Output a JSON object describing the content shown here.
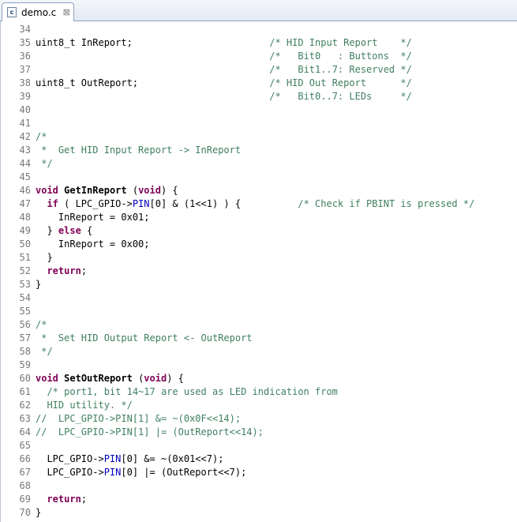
{
  "tab": {
    "title": "demo.c",
    "file_icon_text": "c",
    "close_glyph": "⊠"
  },
  "colors": {
    "keyword": "#7f0055",
    "comment": "#3f7f5f",
    "macro": "#0000c0",
    "line_number": "#787878"
  },
  "lines": [
    {
      "number": "34",
      "segments": []
    },
    {
      "number": "35",
      "segments": [
        {
          "t": "plain",
          "v": "uint8_t InReport;                        "
        },
        {
          "t": "comment",
          "v": "/* HID Input Report    */"
        }
      ]
    },
    {
      "number": "36",
      "segments": [
        {
          "t": "plain",
          "v": "                                         "
        },
        {
          "t": "comment",
          "v": "/*   Bit0   : Buttons  */"
        }
      ]
    },
    {
      "number": "37",
      "segments": [
        {
          "t": "plain",
          "v": "                                         "
        },
        {
          "t": "comment",
          "v": "/*   Bit1..7: Reserved */"
        }
      ]
    },
    {
      "number": "38",
      "segments": [
        {
          "t": "plain",
          "v": "uint8_t OutReport;                       "
        },
        {
          "t": "comment",
          "v": "/* HID Out Report      */"
        }
      ]
    },
    {
      "number": "39",
      "segments": [
        {
          "t": "plain",
          "v": "                                         "
        },
        {
          "t": "comment",
          "v": "/*   Bit0..7: LEDs     */"
        }
      ]
    },
    {
      "number": "40",
      "segments": []
    },
    {
      "number": "41",
      "segments": []
    },
    {
      "number": "42",
      "segments": [
        {
          "t": "comment",
          "v": "/*"
        }
      ]
    },
    {
      "number": "43",
      "segments": [
        {
          "t": "comment",
          "v": " *  Get HID Input Report -> InReport"
        }
      ]
    },
    {
      "number": "44",
      "segments": [
        {
          "t": "comment",
          "v": " */"
        }
      ]
    },
    {
      "number": "45",
      "segments": []
    },
    {
      "number": "46",
      "segments": [
        {
          "t": "keyword",
          "v": "void"
        },
        {
          "t": "plain",
          "v": " "
        },
        {
          "t": "function",
          "v": "GetInReport"
        },
        {
          "t": "plain",
          "v": " ("
        },
        {
          "t": "keyword",
          "v": "void"
        },
        {
          "t": "plain",
          "v": ") {"
        }
      ]
    },
    {
      "number": "47",
      "segments": [
        {
          "t": "plain",
          "v": "  "
        },
        {
          "t": "keyword",
          "v": "if"
        },
        {
          "t": "plain",
          "v": " ( LPC_GPIO->"
        },
        {
          "t": "macro",
          "v": "PIN"
        },
        {
          "t": "plain",
          "v": "[0] & (1<<1) ) {          "
        },
        {
          "t": "comment",
          "v": "/* Check if PBINT is pressed */"
        }
      ]
    },
    {
      "number": "48",
      "segments": [
        {
          "t": "plain",
          "v": "    InReport = 0x01;"
        }
      ]
    },
    {
      "number": "49",
      "segments": [
        {
          "t": "plain",
          "v": "  } "
        },
        {
          "t": "keyword",
          "v": "else"
        },
        {
          "t": "plain",
          "v": " {"
        }
      ]
    },
    {
      "number": "50",
      "segments": [
        {
          "t": "plain",
          "v": "    InReport = 0x00;"
        }
      ]
    },
    {
      "number": "51",
      "segments": [
        {
          "t": "plain",
          "v": "  }"
        }
      ]
    },
    {
      "number": "52",
      "segments": [
        {
          "t": "plain",
          "v": "  "
        },
        {
          "t": "keyword",
          "v": "return"
        },
        {
          "t": "plain",
          "v": ";"
        }
      ]
    },
    {
      "number": "53",
      "segments": [
        {
          "t": "plain",
          "v": "}"
        }
      ]
    },
    {
      "number": "54",
      "segments": []
    },
    {
      "number": "55",
      "segments": []
    },
    {
      "number": "56",
      "segments": [
        {
          "t": "comment",
          "v": "/*"
        }
      ]
    },
    {
      "number": "57",
      "segments": [
        {
          "t": "comment",
          "v": " *  Set HID Output Report <- OutReport"
        }
      ]
    },
    {
      "number": "58",
      "segments": [
        {
          "t": "comment",
          "v": " */"
        }
      ]
    },
    {
      "number": "59",
      "segments": []
    },
    {
      "number": "60",
      "segments": [
        {
          "t": "keyword",
          "v": "void"
        },
        {
          "t": "plain",
          "v": " "
        },
        {
          "t": "function",
          "v": "SetOutReport"
        },
        {
          "t": "plain",
          "v": " ("
        },
        {
          "t": "keyword",
          "v": "void"
        },
        {
          "t": "plain",
          "v": ") {"
        }
      ]
    },
    {
      "number": "61",
      "segments": [
        {
          "t": "plain",
          "v": "  "
        },
        {
          "t": "comment",
          "v": "/* port1, bit 14~17 are used as LED indication from"
        }
      ]
    },
    {
      "number": "62",
      "segments": [
        {
          "t": "comment",
          "v": "  HID utility. */"
        }
      ]
    },
    {
      "number": "63",
      "segments": [
        {
          "t": "comment",
          "v": "//  LPC_GPIO->PIN[1] &= ~(0x0F<<14);"
        }
      ]
    },
    {
      "number": "64",
      "segments": [
        {
          "t": "comment",
          "v": "//  LPC_GPIO->PIN[1] |= (OutReport<<14);"
        }
      ]
    },
    {
      "number": "65",
      "segments": []
    },
    {
      "number": "66",
      "segments": [
        {
          "t": "plain",
          "v": "  LPC_GPIO->"
        },
        {
          "t": "macro",
          "v": "PIN"
        },
        {
          "t": "plain",
          "v": "[0] &= ~(0x01<<7);"
        }
      ]
    },
    {
      "number": "67",
      "segments": [
        {
          "t": "plain",
          "v": "  LPC_GPIO->"
        },
        {
          "t": "macro",
          "v": "PIN"
        },
        {
          "t": "plain",
          "v": "[0] |= (OutReport<<7);"
        }
      ]
    },
    {
      "number": "68",
      "segments": []
    },
    {
      "number": "69",
      "segments": [
        {
          "t": "plain",
          "v": "  "
        },
        {
          "t": "keyword",
          "v": "return"
        },
        {
          "t": "plain",
          "v": ";"
        }
      ]
    },
    {
      "number": "70",
      "segments": [
        {
          "t": "plain",
          "v": "}"
        }
      ]
    }
  ]
}
